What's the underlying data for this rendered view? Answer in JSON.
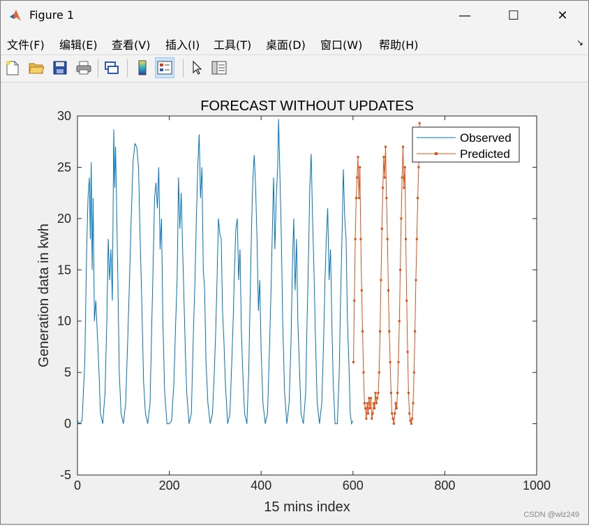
{
  "window": {
    "title": "Figure 1",
    "minimize": "—",
    "maximize": "☐",
    "close": "✕"
  },
  "menu": [
    {
      "label": "文件(F)"
    },
    {
      "label": "编辑(E)"
    },
    {
      "label": "查看(V)"
    },
    {
      "label": "插入(I)"
    },
    {
      "label": "工具(T)"
    },
    {
      "label": "桌面(D)"
    },
    {
      "label": "窗口(W)"
    },
    {
      "label": "帮助(H)"
    }
  ],
  "toolbar": [
    "new-figure-icon",
    "open-file-icon",
    "save-icon",
    "print-icon",
    "link-plot-icon",
    "colorbar-icon",
    "legend-icon",
    "pointer-icon",
    "property-inspector-icon"
  ],
  "watermark": "CSDN @wlz249",
  "chart_data": {
    "type": "line",
    "title": "FORECAST WITHOUT UPDATES",
    "xlabel": "15 mins index",
    "ylabel": "Generation data in kwh",
    "xlim": [
      0,
      1000
    ],
    "ylim": [
      -5,
      30
    ],
    "xticks": [
      0,
      200,
      400,
      600,
      800,
      1000
    ],
    "yticks": [
      -5,
      0,
      5,
      10,
      15,
      20,
      25,
      30
    ],
    "legend_position": "top-right",
    "series": [
      {
        "name": "Observed",
        "color": "#0072bd",
        "marker": "none",
        "points": [
          [
            0,
            0.3
          ],
          [
            4,
            0
          ],
          [
            10,
            0.3
          ],
          [
            16,
            6
          ],
          [
            20,
            17
          ],
          [
            23,
            22
          ],
          [
            26,
            24
          ],
          [
            28,
            18
          ],
          [
            30,
            25.5
          ],
          [
            32,
            15
          ],
          [
            34,
            22
          ],
          [
            37,
            10
          ],
          [
            40,
            12
          ],
          [
            44,
            8
          ],
          [
            47,
            5
          ],
          [
            50,
            1
          ],
          [
            55,
            0
          ],
          [
            60,
            3
          ],
          [
            64,
            10
          ],
          [
            67,
            18
          ],
          [
            70,
            14
          ],
          [
            73,
            17
          ],
          [
            76,
            12
          ],
          [
            79,
            28.7
          ],
          [
            81,
            23
          ],
          [
            83,
            27
          ],
          [
            85,
            22
          ],
          [
            88,
            14
          ],
          [
            91,
            5
          ],
          [
            95,
            1
          ],
          [
            100,
            0
          ],
          [
            105,
            2
          ],
          [
            110,
            9
          ],
          [
            114,
            15
          ],
          [
            117,
            20
          ],
          [
            121,
            25.5
          ],
          [
            125,
            27.3
          ],
          [
            129,
            27
          ],
          [
            133,
            25
          ],
          [
            136,
            19
          ],
          [
            140,
            12
          ],
          [
            144,
            4
          ],
          [
            148,
            1
          ],
          [
            153,
            0
          ],
          [
            158,
            2
          ],
          [
            162,
            10
          ],
          [
            165,
            16
          ],
          [
            168,
            22
          ],
          [
            171,
            23.5
          ],
          [
            174,
            21
          ],
          [
            177,
            25
          ],
          [
            180,
            17
          ],
          [
            183,
            20
          ],
          [
            186,
            10
          ],
          [
            190,
            3
          ],
          [
            195,
            0
          ],
          [
            200,
            0
          ],
          [
            205,
            0.3
          ],
          [
            210,
            4
          ],
          [
            214,
            10
          ],
          [
            217,
            14
          ],
          [
            220,
            24
          ],
          [
            223,
            19
          ],
          [
            226,
            22.5
          ],
          [
            229,
            17
          ],
          [
            232,
            12
          ],
          [
            235,
            7
          ],
          [
            238,
            3
          ],
          [
            243,
            0
          ],
          [
            248,
            1
          ],
          [
            252,
            8
          ],
          [
            256,
            14
          ],
          [
            259,
            20
          ],
          [
            262,
            25
          ],
          [
            265,
            28.2
          ],
          [
            268,
            22
          ],
          [
            271,
            25
          ],
          [
            274,
            15
          ],
          [
            277,
            13
          ],
          [
            280,
            6
          ],
          [
            284,
            2
          ],
          [
            289,
            0
          ],
          [
            294,
            1
          ],
          [
            298,
            5
          ],
          [
            301,
            9
          ],
          [
            304,
            14
          ],
          [
            307,
            20
          ],
          [
            310,
            18.5
          ],
          [
            313,
            18
          ],
          [
            316,
            11
          ],
          [
            319,
            8
          ],
          [
            322,
            4
          ],
          [
            327,
            0
          ],
          [
            332,
            1
          ],
          [
            336,
            6
          ],
          [
            339,
            10
          ],
          [
            342,
            15
          ],
          [
            345,
            19
          ],
          [
            348,
            20
          ],
          [
            351,
            14
          ],
          [
            354,
            17
          ],
          [
            357,
            9
          ],
          [
            360,
            5
          ],
          [
            364,
            1
          ],
          [
            369,
            0
          ],
          [
            373,
            5
          ],
          [
            376,
            12
          ],
          [
            379,
            19
          ],
          [
            382,
            24
          ],
          [
            385,
            26.2
          ],
          [
            388,
            23
          ],
          [
            391,
            18
          ],
          [
            394,
            11
          ],
          [
            397,
            14
          ],
          [
            400,
            7
          ],
          [
            404,
            2
          ],
          [
            409,
            0
          ],
          [
            414,
            1
          ],
          [
            418,
            7
          ],
          [
            421,
            12
          ],
          [
            424,
            18
          ],
          [
            427,
            24
          ],
          [
            430,
            17
          ],
          [
            433,
            22
          ],
          [
            436,
            25
          ],
          [
            438,
            29.7
          ],
          [
            441,
            24
          ],
          [
            444,
            18
          ],
          [
            447,
            10
          ],
          [
            451,
            3
          ],
          [
            456,
            0
          ],
          [
            461,
            2
          ],
          [
            465,
            8
          ],
          [
            468,
            15
          ],
          [
            471,
            20
          ],
          [
            474,
            13
          ],
          [
            477,
            18
          ],
          [
            480,
            10
          ],
          [
            483,
            6
          ],
          [
            487,
            1
          ],
          [
            492,
            0
          ],
          [
            497,
            3
          ],
          [
            500,
            10
          ],
          [
            503,
            16
          ],
          [
            506,
            23
          ],
          [
            509,
            26.3
          ],
          [
            512,
            20
          ],
          [
            515,
            15
          ],
          [
            518,
            9
          ],
          [
            522,
            2
          ],
          [
            527,
            0
          ],
          [
            532,
            2
          ],
          [
            536,
            8
          ],
          [
            539,
            14
          ],
          [
            542,
            18
          ],
          [
            545,
            21
          ],
          [
            548,
            14
          ],
          [
            551,
            17
          ],
          [
            554,
            10
          ],
          [
            557,
            4
          ],
          [
            561,
            0
          ],
          [
            566,
            0
          ],
          [
            570,
            5
          ],
          [
            573,
            12
          ],
          [
            576,
            18
          ],
          [
            579,
            24.8
          ],
          [
            582,
            20
          ],
          [
            585,
            18
          ],
          [
            588,
            10
          ],
          [
            591,
            6
          ],
          [
            594,
            1
          ],
          [
            597,
            0
          ],
          [
            600,
            0.3
          ]
        ]
      },
      {
        "name": "Predicted",
        "color": "#d95319",
        "marker": "square",
        "points": [
          [
            601,
            6
          ],
          [
            603,
            12
          ],
          [
            605,
            18
          ],
          [
            607,
            22
          ],
          [
            609,
            24
          ],
          [
            611,
            26
          ],
          [
            613,
            22
          ],
          [
            615,
            25
          ],
          [
            617,
            18
          ],
          [
            619,
            13
          ],
          [
            621,
            9
          ],
          [
            623,
            5
          ],
          [
            625,
            2
          ],
          [
            627,
            1.5
          ],
          [
            629,
            0.5
          ],
          [
            631,
            2
          ],
          [
            633,
            1
          ],
          [
            635,
            2.5
          ],
          [
            637,
            1.5
          ],
          [
            639,
            2.5
          ],
          [
            641,
            0.5
          ],
          [
            643,
            1
          ],
          [
            645,
            2
          ],
          [
            647,
            1.5
          ],
          [
            649,
            3
          ],
          [
            651,
            2
          ],
          [
            653,
            2.5
          ],
          [
            655,
            3
          ],
          [
            657,
            5
          ],
          [
            659,
            9
          ],
          [
            661,
            14
          ],
          [
            663,
            19
          ],
          [
            665,
            23
          ],
          [
            667,
            26
          ],
          [
            669,
            24
          ],
          [
            671,
            27
          ],
          [
            673,
            22
          ],
          [
            675,
            18
          ],
          [
            677,
            13
          ],
          [
            679,
            9
          ],
          [
            681,
            6
          ],
          [
            683,
            3
          ],
          [
            685,
            1
          ],
          [
            687,
            0.5
          ],
          [
            689,
            0
          ],
          [
            691,
            1
          ],
          [
            693,
            2
          ],
          [
            695,
            1.5
          ],
          [
            697,
            3
          ],
          [
            699,
            6
          ],
          [
            701,
            10
          ],
          [
            703,
            15
          ],
          [
            705,
            20
          ],
          [
            707,
            24
          ],
          [
            709,
            27
          ],
          [
            711,
            23
          ],
          [
            713,
            25
          ],
          [
            715,
            18
          ],
          [
            717,
            12
          ],
          [
            719,
            7
          ],
          [
            721,
            3
          ],
          [
            723,
            1
          ],
          [
            725,
            0.3
          ],
          [
            727,
            0
          ],
          [
            729,
            0.5
          ],
          [
            731,
            2
          ],
          [
            733,
            5
          ],
          [
            735,
            9
          ],
          [
            737,
            14
          ],
          [
            739,
            18
          ],
          [
            741,
            22
          ],
          [
            743,
            25
          ],
          [
            745,
            29.3
          ]
        ]
      }
    ]
  }
}
